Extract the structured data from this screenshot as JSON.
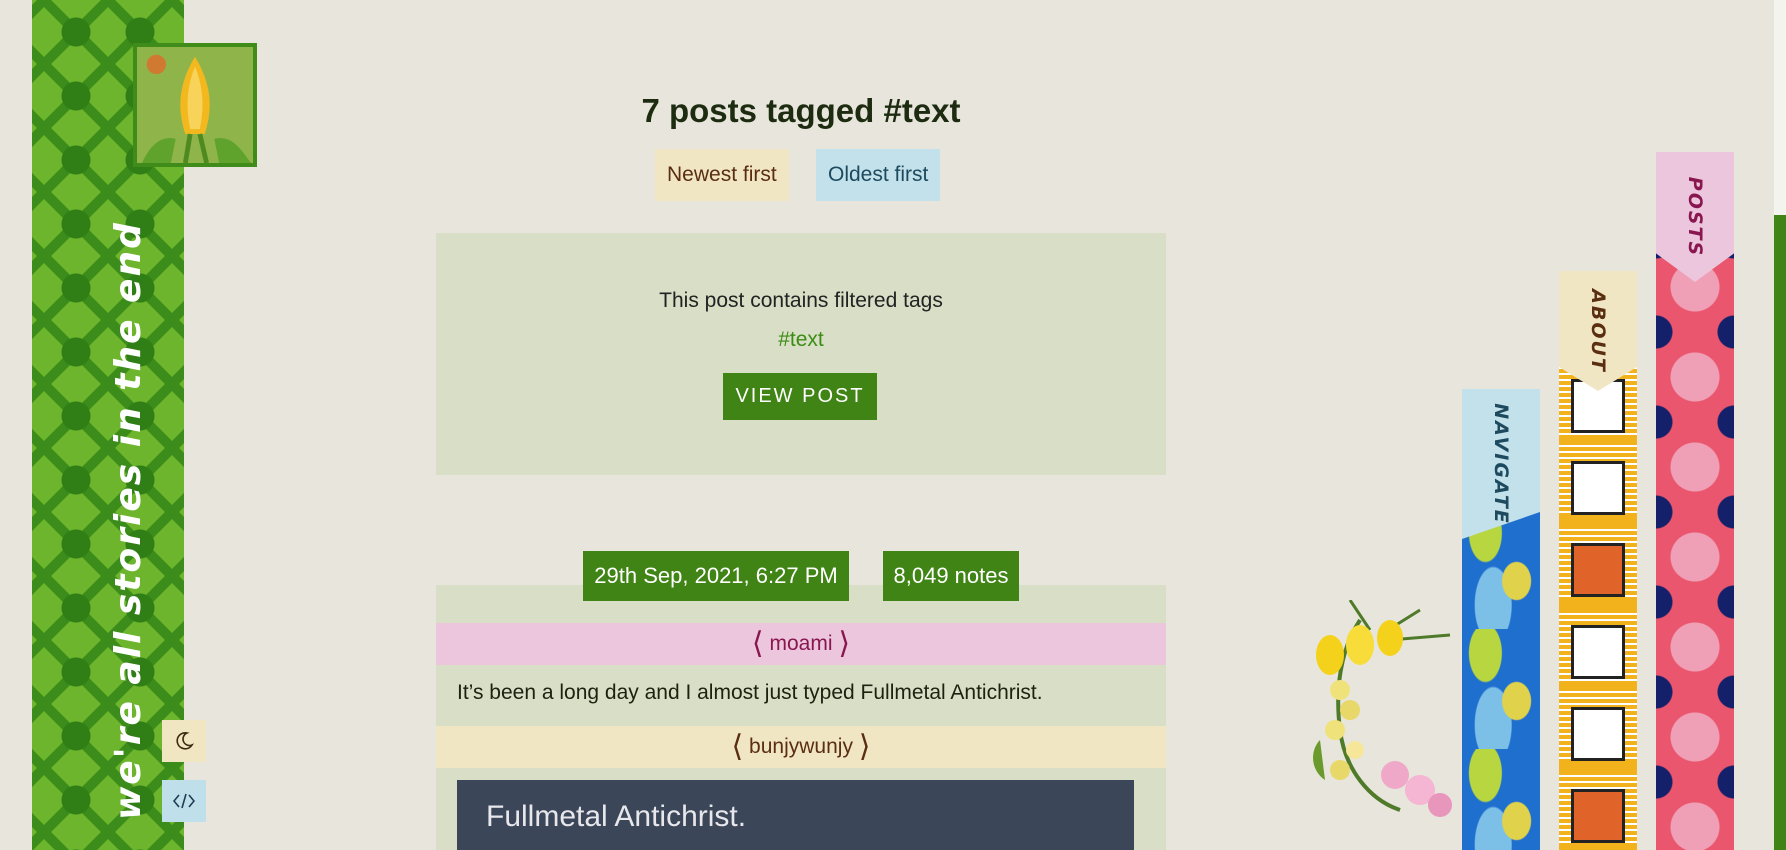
{
  "sidebar": {
    "title": "we're all stories in the end",
    "theme_toggle_icon": "moon-icon",
    "code_icon": "code-icon"
  },
  "header": {
    "title": "7 posts tagged #text",
    "sort_newest": "Newest first",
    "sort_oldest": "Oldest first"
  },
  "filtered_post": {
    "message": "This post contains filtered tags",
    "tag": "#text",
    "button": "VIEW POST"
  },
  "post": {
    "date": "29th Sep, 2021, 6:27 PM",
    "notes": "8,049 notes",
    "reblogs": [
      {
        "user": "moami",
        "text": "It’s been a long day and I almost just typed Fullmetal Antichrist."
      },
      {
        "user": "bunjywunjy"
      }
    ],
    "image_text": "Fullmetal Antichrist."
  },
  "nav_tabs": {
    "navigate": "NAVIGATE",
    "about": "ABOUT",
    "posts": "POSTS"
  },
  "colors": {
    "accent": "#3f8414",
    "background": "#e8e6dc",
    "card": "#d9dfc7",
    "pink": "#ebc6dc",
    "cream": "#f1e6c4",
    "light_blue": "#c3e1ea"
  }
}
